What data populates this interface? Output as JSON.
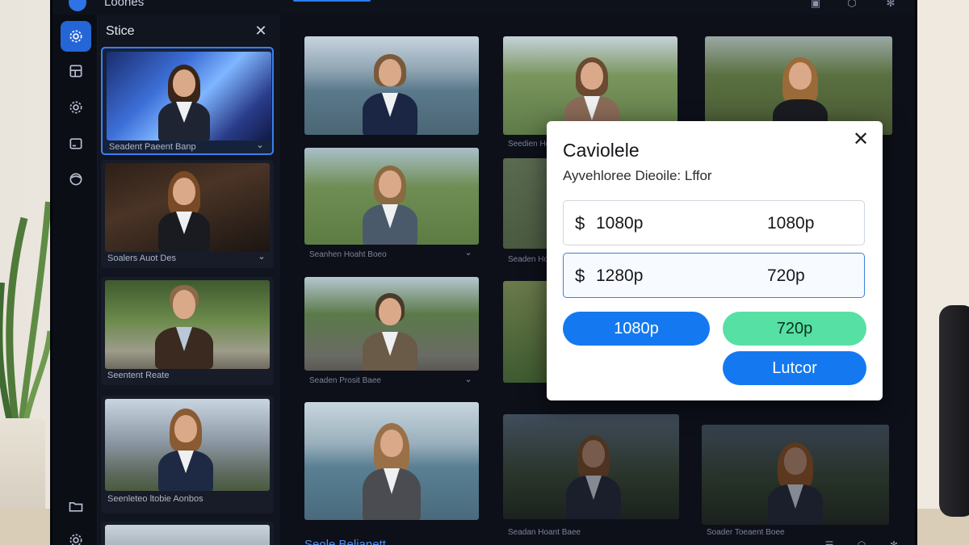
{
  "app": {
    "title": "Loones"
  },
  "panel": {
    "title": "Stice",
    "cards": [
      {
        "label": "Seadent Paeent Banp"
      },
      {
        "label": "Soalers Auot Des"
      },
      {
        "label": "Seentent Reate"
      },
      {
        "label": "Seenleteo ltobie Aonbos"
      }
    ]
  },
  "grid": {
    "labels": [
      "Seanhen Hoaht Boeo",
      "Seaden Prosit Baee",
      "Seedien Hoaant Boee",
      "Seaden Hoant Boee",
      "Seadan Hoant Baee",
      "Soader Toeaent Boee"
    ],
    "bottom_label": "Seole Belianett"
  },
  "dialog": {
    "title": "Caviolele",
    "subtitle": "Ayvehloree Dieoile: Lffor",
    "options": [
      {
        "currency": "$",
        "left": "1080p",
        "right": "1080p"
      },
      {
        "currency": "$",
        "left": "1280p",
        "right": "720p"
      }
    ],
    "buttons": {
      "primary": "1080p",
      "secondary": "720p",
      "confirm": "Lutcor"
    }
  },
  "colors": {
    "accent": "#1479f0",
    "success": "#57e0a4",
    "selected_border": "#3d7ff0",
    "background": "#0c0f17"
  }
}
